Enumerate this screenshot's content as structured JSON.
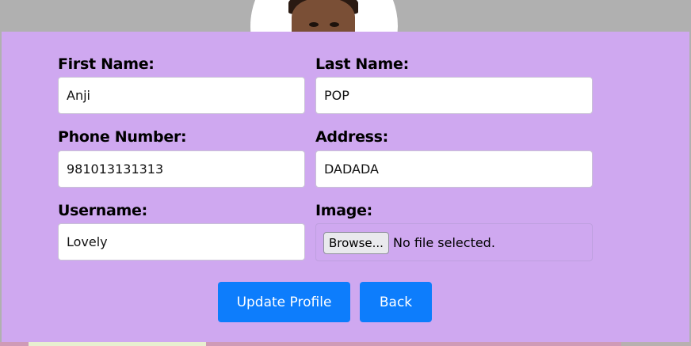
{
  "form": {
    "first_name": {
      "label": "First Name:",
      "value": "Anji"
    },
    "last_name": {
      "label": "Last Name:",
      "value": "POP"
    },
    "phone": {
      "label": "Phone Number:",
      "value": "981013131313"
    },
    "address": {
      "label": "Address:",
      "value": "DADADA"
    },
    "username": {
      "label": "Username:",
      "value": "Lovely"
    },
    "image": {
      "label": "Image:",
      "browse_label": "Browse...",
      "status": "No file selected."
    }
  },
  "actions": {
    "update_label": "Update Profile",
    "back_label": "Back"
  },
  "colors": {
    "card_bg": "#cfa8f0",
    "page_bg": "#b0b0b0",
    "button_bg": "#0d7dfc"
  }
}
